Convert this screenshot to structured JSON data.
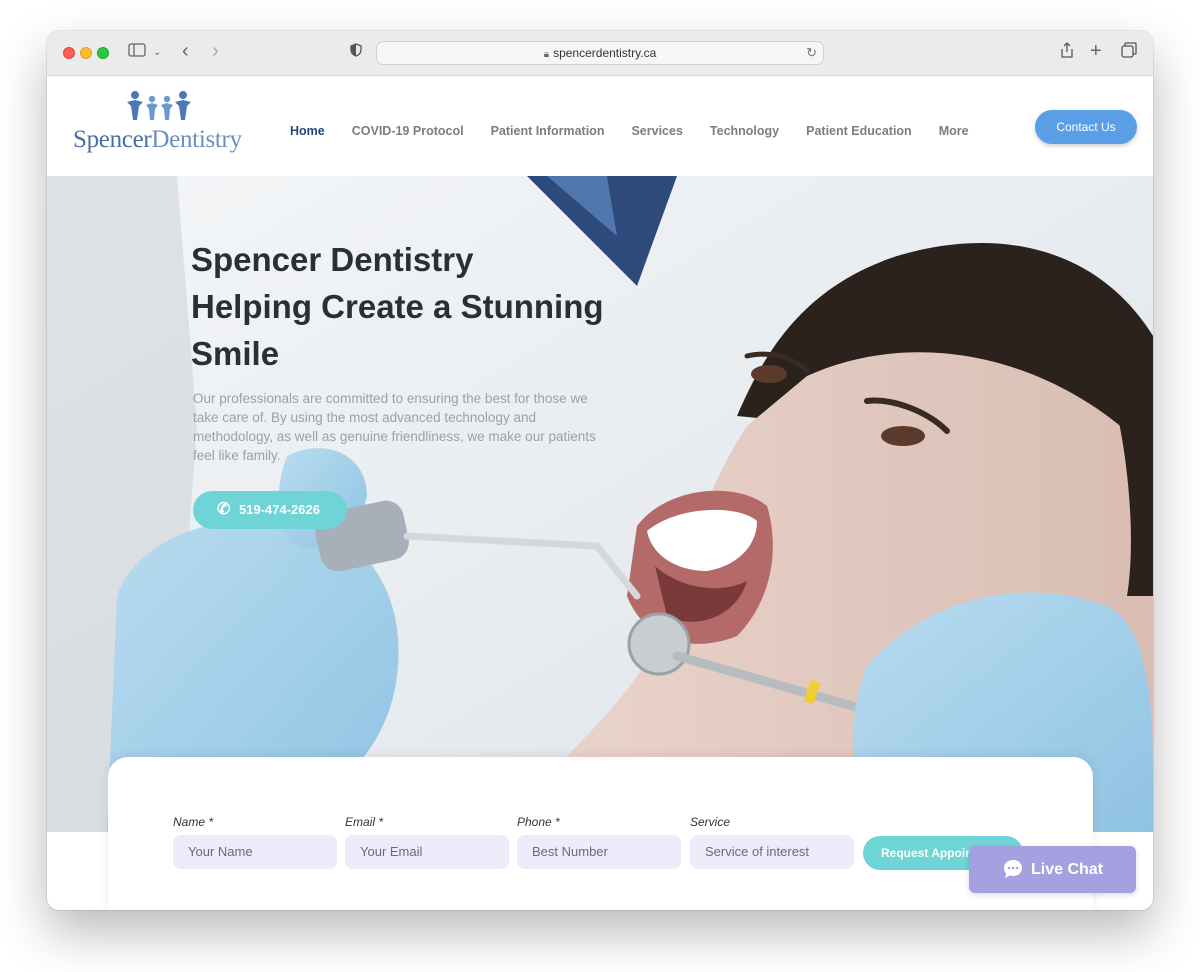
{
  "browser": {
    "url": "spencerdentistry.ca",
    "icons": [
      "sidebar-icon",
      "chevron-down-icon",
      "back-icon",
      "forward-icon",
      "shield-icon",
      "lock-icon",
      "reload-icon",
      "share-icon",
      "new-tab-icon",
      "tabs-icon"
    ]
  },
  "header": {
    "logo_main": "Spencer",
    "logo_rest": "Dentistry",
    "nav": [
      "Home",
      "COVID-19 Protocol",
      "Patient Information",
      "Services",
      "Technology",
      "Patient Education",
      "More"
    ],
    "contact_label": "Contact Us"
  },
  "hero": {
    "title_line1": "Spencer Dentistry",
    "title_line2": "Helping Create a Stunning",
    "title_line3": "Smile",
    "description": "Our professionals are committed to ensuring the best for those we take care of. By using the most advanced technology and methodology, as well as genuine friendliness, we make our patients feel like family.",
    "phone": "519-474-2626"
  },
  "form": {
    "name_label": "Name *",
    "name_placeholder": "Your Name",
    "email_label": "Email *",
    "email_placeholder": "Your Email",
    "phone_label": "Phone *",
    "phone_placeholder": "Best Number",
    "service_label": "Service",
    "service_placeholder": "Service of interest",
    "submit_label": "Request Appoin"
  },
  "chat": {
    "label": "Live Chat"
  },
  "colors": {
    "accent_blue": "#5a9fe6",
    "teal": "#6fd4d6",
    "nav_active": "#24487a",
    "chat_purple": "#a5a0e0",
    "input_bg": "#ececfb"
  }
}
